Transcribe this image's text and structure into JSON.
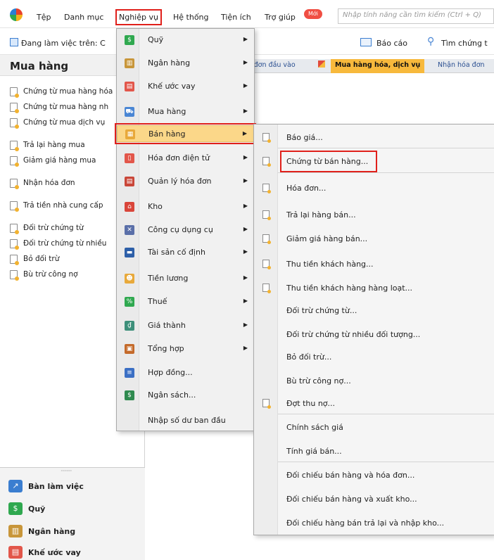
{
  "menubar": {
    "items": [
      "Tệp",
      "Danh mục",
      "Nghiệp vụ",
      "Hệ thống",
      "Tiện ích",
      "Trợ giúp"
    ],
    "new_badge": "Mới",
    "search_placeholder": "Nhập tính năng cần tìm kiếm (Ctrl + Q)"
  },
  "toolbar": {
    "workspace_label": "Đang làm việc trên: C",
    "report_label": "Báo cáo",
    "search_label": "Tìm chứng t"
  },
  "left_panel": {
    "title": "Mua hàng",
    "items": [
      "Chứng từ mua hàng hóa",
      "Chứng từ mua hàng nh",
      "Chứng từ mua dịch vụ",
      "Trả lại hàng mua",
      "Giảm giá hàng mua",
      "Nhận hóa đơn",
      "Trả tiền nhà cung cấp",
      "Đối trừ chứng từ",
      "Đối trừ chứng từ nhiều",
      "Bỏ đối trừ",
      "Bù trừ công nợ"
    ],
    "nav_items": [
      "Bàn làm việc",
      "Quỹ",
      "Ngân hàng",
      "Khế ước vay"
    ]
  },
  "tabs": [
    "óa đơn đầu vào",
    "Mua hàng hóa, dịch vụ",
    "Nhận hóa đơn"
  ],
  "main_menu": {
    "items": [
      {
        "label": "Quỹ",
        "icon": "cash-icon",
        "submenu": true
      },
      {
        "label": "Ngân hàng",
        "icon": "bank-icon",
        "submenu": true
      },
      {
        "label": "Khế ước vay",
        "icon": "loan-icon",
        "submenu": true
      },
      {
        "label": "Mua hàng",
        "icon": "cart-icon",
        "submenu": true
      },
      {
        "label": "Bán hàng",
        "icon": "sales-icon",
        "submenu": true
      },
      {
        "label": "Hóa đơn điện tử",
        "icon": "e-invoice-icon",
        "submenu": true
      },
      {
        "label": "Quản lý hóa đơn",
        "icon": "invoice-manage-icon",
        "submenu": true
      },
      {
        "label": "Kho",
        "icon": "warehouse-icon",
        "submenu": true
      },
      {
        "label": "Công cụ dụng cụ",
        "icon": "tools-icon",
        "submenu": true
      },
      {
        "label": "Tài sản cố định",
        "icon": "fixed-asset-icon",
        "submenu": true
      },
      {
        "label": "Tiền lương",
        "icon": "salary-icon",
        "submenu": true
      },
      {
        "label": "Thuế",
        "icon": "tax-icon",
        "submenu": true
      },
      {
        "label": "Giá thành",
        "icon": "cost-icon",
        "submenu": true
      },
      {
        "label": "Tổng hợp",
        "icon": "summary-icon",
        "submenu": true
      },
      {
        "label": "Hợp đồng...",
        "icon": "contract-icon",
        "submenu": false
      },
      {
        "label": "Ngân sách...",
        "icon": "budget-icon",
        "submenu": false
      },
      {
        "label": "Nhập số dư ban đầu",
        "icon": "",
        "submenu": false
      }
    ]
  },
  "sub_menu": {
    "items": [
      {
        "label": "Báo giá...",
        "icon": true
      },
      {
        "label": "Chứng từ bán hàng...",
        "icon": true
      },
      {
        "label": "Hóa đơn...",
        "icon": true
      },
      {
        "label": "Trả lại hàng bán...",
        "icon": true
      },
      {
        "label": "Giảm giá hàng bán...",
        "icon": true
      },
      {
        "label": "Thu tiền khách hàng...",
        "icon": true
      },
      {
        "label": "Thu tiền khách hàng hàng loạt...",
        "icon": true
      },
      {
        "label": "Đối trừ chứng từ...",
        "icon": false
      },
      {
        "label": "Đối trừ chứng từ nhiều đối tượng...",
        "icon": false
      },
      {
        "label": "Bỏ đối trừ...",
        "icon": false
      },
      {
        "label": "Bù trừ công nợ...",
        "icon": false
      },
      {
        "label": "Đợt thu nợ...",
        "icon": true
      },
      {
        "label": "Chính sách giá",
        "icon": false
      },
      {
        "label": "Tính giá bán...",
        "icon": false
      },
      {
        "label": "Đối chiếu bán hàng và hóa đơn...",
        "icon": false
      },
      {
        "label": "Đối chiếu bán hàng và xuất kho...",
        "icon": false
      },
      {
        "label": "Đối chiếu hàng bán trả lại và nhập kho...",
        "icon": false
      }
    ]
  }
}
